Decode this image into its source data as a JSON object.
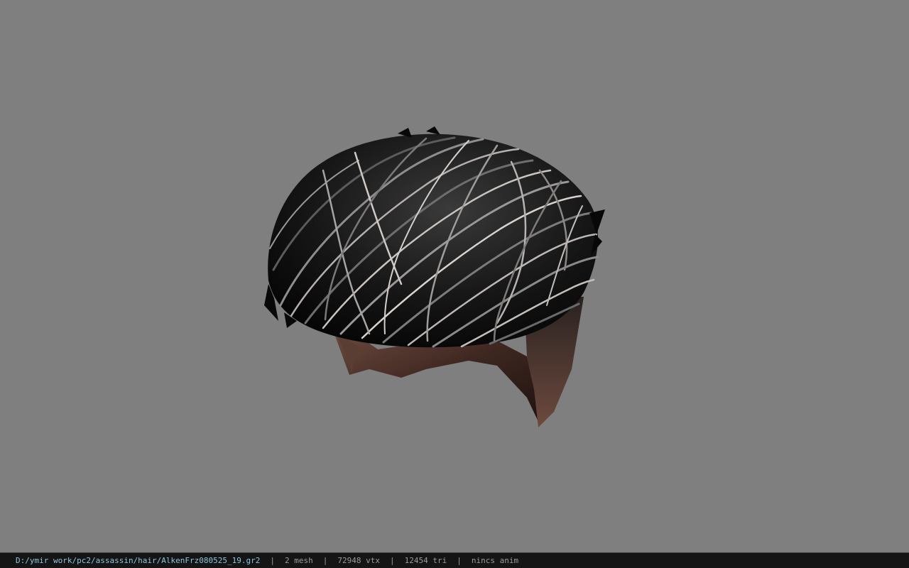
{
  "viewer": {
    "background_color": "#7f7f7f",
    "model_icon": "hair-mesh-model"
  },
  "status": {
    "file_path": "D:/ymir work/pc2/assassin/hair/AlkenFrz080525_19.gr2",
    "separator": "|",
    "mesh_count": "2 mesh",
    "vertex_count": "72948 vtx",
    "triangle_count": "12454 tri",
    "animation": "nincs anim",
    "path_color": "#8fc3dc",
    "text_color": "#9a9a9a",
    "bar_color": "#151515"
  }
}
